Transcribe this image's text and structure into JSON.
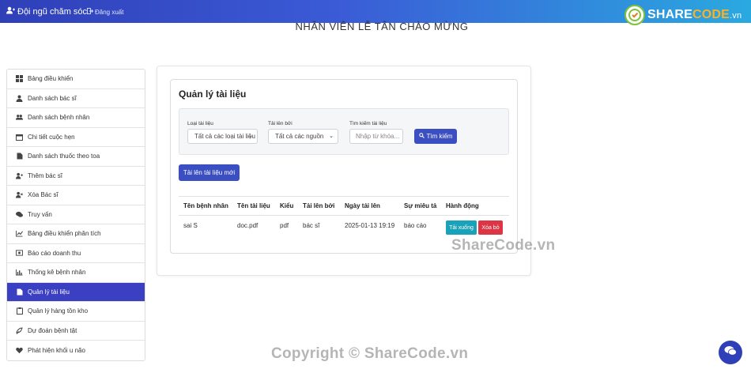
{
  "header": {
    "brand_label": "Đội ngũ chăm sóc",
    "logout_label": "Đăng xuất",
    "logo_main": "SHARE",
    "logo_accent": "CODE",
    "logo_tld": ".vn"
  },
  "welcome": "NHÂN VIÊN LỄ TÂN CHÀO MỪNG",
  "sidebar": {
    "items": [
      {
        "label": "Bảng điều khiển",
        "icon": "dashboard-icon"
      },
      {
        "label": "Danh sách bác sĩ",
        "icon": "doctor-icon"
      },
      {
        "label": "Danh sách bệnh nhân",
        "icon": "users-icon"
      },
      {
        "label": "Chi tiết cuộc hẹn",
        "icon": "calendar-icon"
      },
      {
        "label": "Danh sách thuốc theo toa",
        "icon": "file-icon"
      },
      {
        "label": "Thêm bác sĩ",
        "icon": "user-plus-icon"
      },
      {
        "label": "Xóa Bác sĩ",
        "icon": "user-times-icon"
      },
      {
        "label": "Truy vấn",
        "icon": "comments-icon"
      },
      {
        "label": "Bảng điều khiển phân tích",
        "icon": "chart-line-icon"
      },
      {
        "label": "Báo cáo doanh thu",
        "icon": "money-icon"
      },
      {
        "label": "Thống kê bệnh nhân",
        "icon": "chart-bar-icon"
      },
      {
        "label": "Quản lý tài liệu",
        "icon": "document-icon"
      },
      {
        "label": "Quản lý hàng tồn kho",
        "icon": "clipboard-icon"
      },
      {
        "label": "Dự đoán bệnh tật",
        "icon": "predict-icon"
      },
      {
        "label": "Phát hiện khối u não",
        "icon": "heartbeat-icon"
      }
    ],
    "active_index": 11
  },
  "main": {
    "title": "Quản lý tài liệu",
    "filters": {
      "doc_type_label": "Loại tài liệu",
      "doc_type_value": "Tất cả các loại tài liệu",
      "uploaded_by_label": "Tải lên bởi",
      "uploaded_by_value": "Tất cả các nguồn",
      "search_label": "Tìm kiếm tài liệu",
      "search_placeholder": "Nhập từ khóa...",
      "search_button": "Tìm kiếm"
    },
    "upload_button": "Tải lên tài liệu mới",
    "table": {
      "headers": [
        "Tên bệnh nhân",
        "Tên tài liệu",
        "Kiểu",
        "Tải lên bởi",
        "Ngày tải lên",
        "Sự miêu tả",
        "Hành động"
      ],
      "rows": [
        [
          "sai S",
          "doc.pdf",
          "pdf",
          "bác sĩ",
          "2025-01-13 19:19",
          "báo cáo"
        ]
      ],
      "download_label": "Tải xuống",
      "delete_label": "Xóa bỏ"
    }
  },
  "watermark": {
    "center": "ShareCode.vn",
    "bottom": "Copyright © ShareCode.vn"
  },
  "colors": {
    "primary": "#3b4fc2",
    "active_sidebar": "#3b3fc2",
    "download": "#1aa2b8",
    "delete": "#dc3545"
  }
}
